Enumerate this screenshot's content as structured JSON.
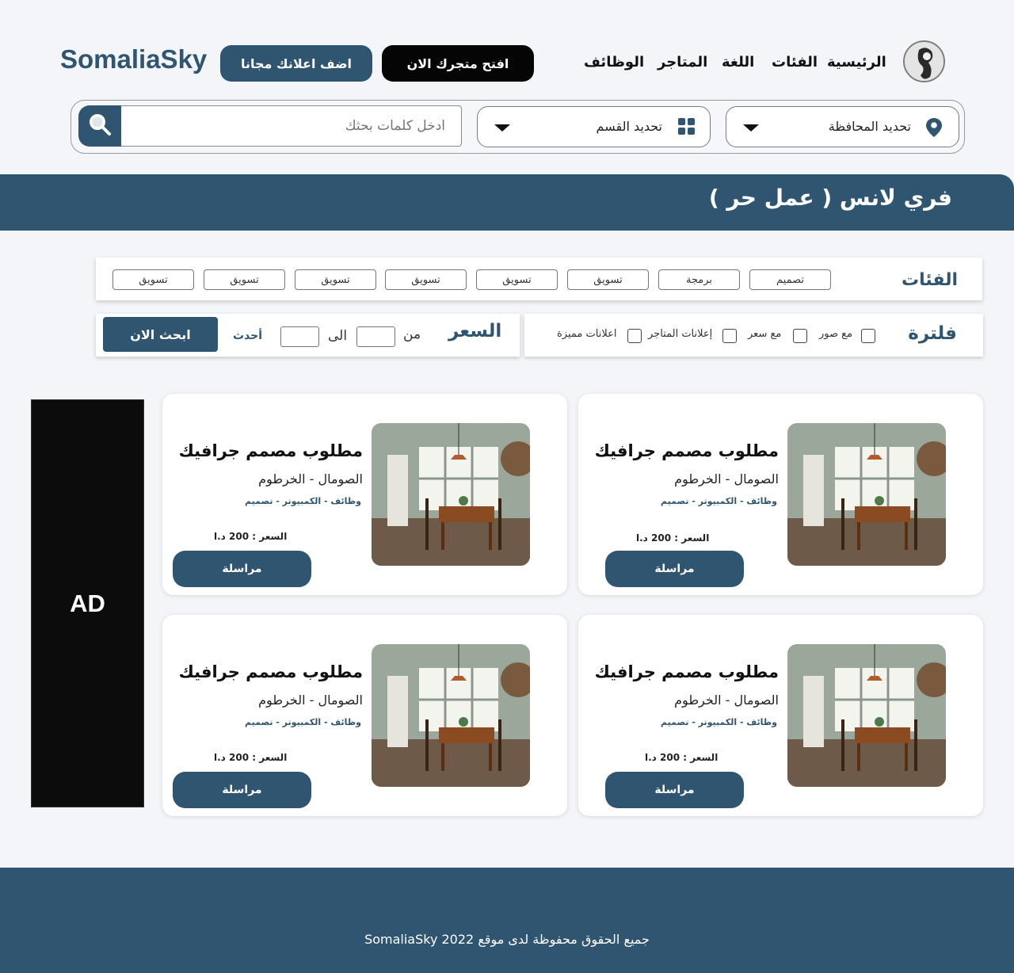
{
  "header": {
    "brand": "SomaliaSky",
    "nav": [
      "الرئيسية",
      "الفئات",
      "اللغة",
      "المتاجر",
      "الوظائف"
    ],
    "open_store_button": "افتح متجرك الان",
    "add_ad_button": "اضف اعلانك مجانا"
  },
  "search": {
    "province_select": "تحديد المحافظة",
    "section_select": "تحديد القسم",
    "input_placeholder": "ادخل كلمات بحثك"
  },
  "banner": {
    "title": "فري لانس ( عمل حر )"
  },
  "categories": {
    "title": "الفئات",
    "chips": [
      "تصميم",
      "برمجة",
      "تسويق",
      "تسويق",
      "تسويق",
      "تسويق",
      "تسويق",
      "تسويق"
    ]
  },
  "filter": {
    "title": "فلترة",
    "options": [
      "مع صور",
      "مع سعر",
      "إعلانات المتاجر",
      "اعلانات مميزة"
    ]
  },
  "price": {
    "title": "السعر",
    "from_label": "من",
    "to_label": "الى",
    "latest_label": "أحدث",
    "search_button": "ابحث الان"
  },
  "ad": {
    "label": "AD"
  },
  "cards": [
    {
      "title": "مطلوب مصمم جرافيك",
      "location": "الصومال - الخرطوم",
      "tags": "وظائف - الكمبيوتر - تصميم",
      "price": "السعر : 200 د.ا",
      "button": "مراسلة"
    },
    {
      "title": "مطلوب مصمم جرافيك",
      "location": "الصومال - الخرطوم",
      "tags": "وظائف - الكمبيوتر - تصميم",
      "price": "السعر : 200 د.ا",
      "button": "مراسلة"
    },
    {
      "title": "مطلوب مصمم جرافيك",
      "location": "الصومال - الخرطوم",
      "tags": "وظائف - الكمبيوتر - تصميم",
      "price": "السعر : 200 د.ا",
      "button": "مراسلة"
    },
    {
      "title": "مطلوب مصمم جرافيك",
      "location": "الصومال - الخرطوم",
      "tags": "وظائف - الكمبيوتر - تصميم",
      "price": "السعر : 200 د.ا",
      "button": "مراسلة"
    }
  ],
  "footer": {
    "copyright": "SomaliaSky 2022 جميع الحقوق محفوظة لدى موقع"
  },
  "colors": {
    "primary": "#2f5571",
    "background": "#f4f5f9",
    "dark_button": "#050505",
    "ad_background": "#0c0c0c"
  },
  "icons": [
    "user-avatar-icon",
    "location-pin-icon",
    "grid-icon",
    "chevron-down-icon",
    "search-icon"
  ]
}
